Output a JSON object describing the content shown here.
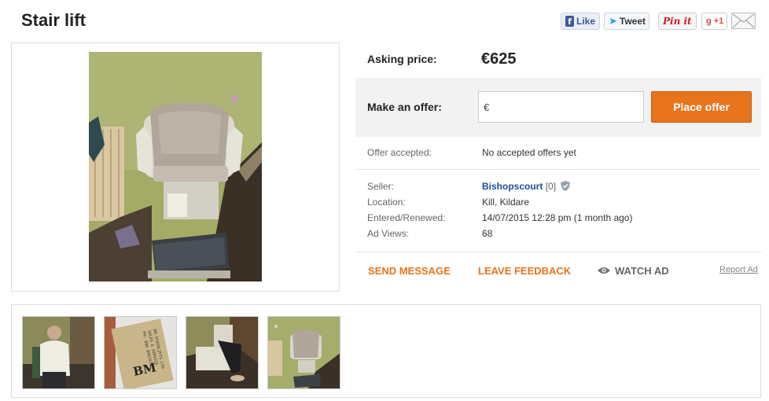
{
  "title": "Stair lift",
  "share": {
    "like": "Like",
    "tweet": "Tweet",
    "pin": "Pin it",
    "gplus": "+1"
  },
  "listing": {
    "asking_price_label": "Asking price:",
    "asking_price": "€625",
    "offer_label": "Make an offer:",
    "offer_input_value": "€",
    "place_offer": "Place offer",
    "offer_accepted_label": "Offer accepted:",
    "offer_accepted_value": "No accepted offers yet",
    "seller_label": "Seller:",
    "seller_name": "Bishopscourt",
    "seller_rating": "[0]",
    "location_label": "Location:",
    "location_value": "Kill, Kildare",
    "entered_label": "Entered/Renewed:",
    "entered_value": "14/07/2015 12:28 pm (1 month ago)",
    "views_label": "Ad Views:",
    "views_value": "68"
  },
  "actions": {
    "send_message": "SEND MESSAGE",
    "leave_feedback": "LEAVE FEEDBACK",
    "watch_ad": "WATCH AD",
    "report_ad": "Report Ad"
  },
  "colors": {
    "accent": "#e8741c",
    "link": "#1a4e9c",
    "wall": "#a7b06a"
  },
  "thumb_card_text": {
    "initials": "BM",
    "lines": [
      "BM STAIRLIFTS LTD",
      "SALES & SERVICE",
      "PH: 086 8467676"
    ]
  }
}
